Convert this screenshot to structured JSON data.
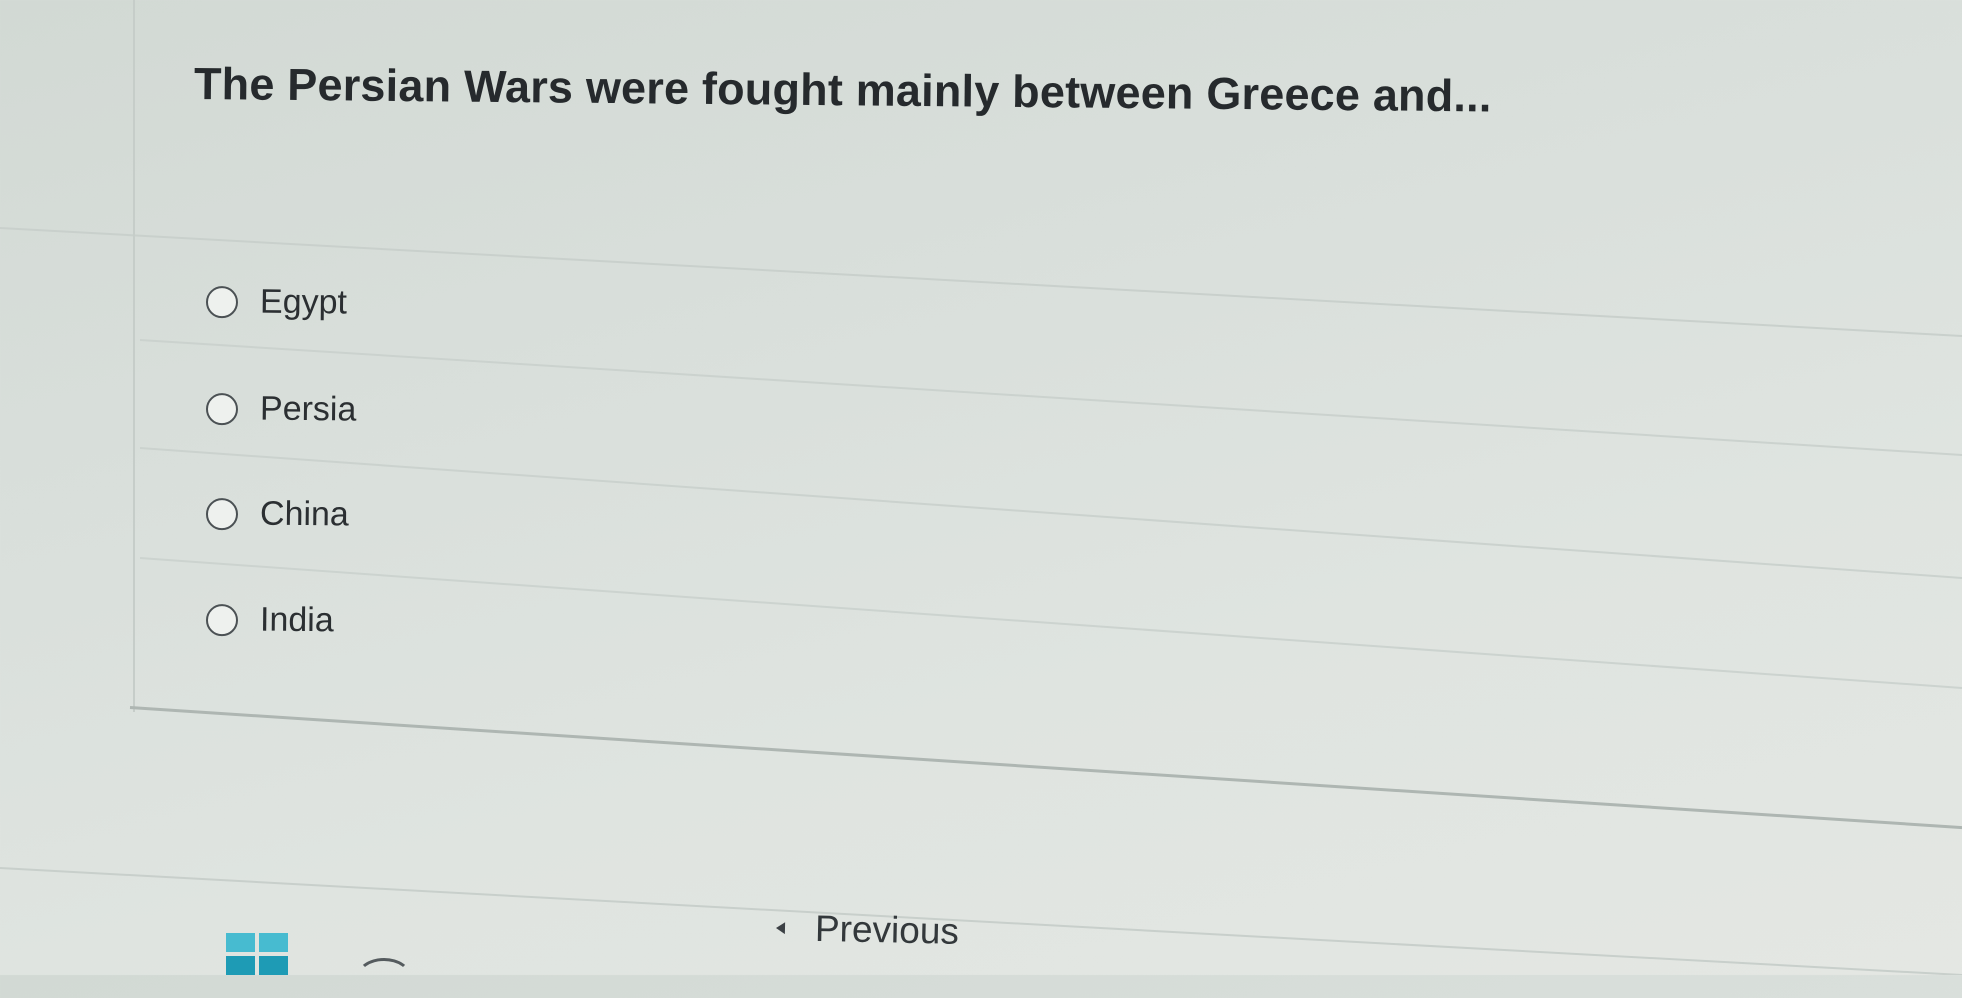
{
  "question": {
    "text": "The Persian Wars were fought mainly between Greece and..."
  },
  "choices": [
    {
      "label": "Egypt",
      "selected": false
    },
    {
      "label": "Persia",
      "selected": false
    },
    {
      "label": "China",
      "selected": false
    },
    {
      "label": "India",
      "selected": false
    }
  ],
  "navigation": {
    "previous_label": "Previous"
  },
  "colors": {
    "background": "#dde2de",
    "text": "#262a2d",
    "taskbar_icon": "#1e9bb5"
  },
  "icons": {
    "previous": "chevron-left-icon",
    "taskbar": "windows-icon",
    "radio": "radio-circle-icon"
  }
}
